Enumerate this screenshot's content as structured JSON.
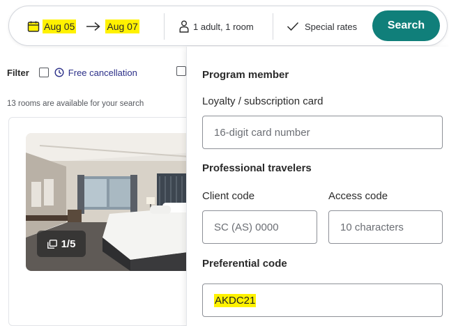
{
  "search": {
    "checkin": "Aug 05",
    "checkout": "Aug 07",
    "guests": "1 adult, 1 room",
    "special_rates": "Special rates",
    "search_label": "Search"
  },
  "filter": {
    "label": "Filter",
    "free_cancellation": "Free cancellation"
  },
  "results": {
    "count_text": "13 rooms are available for your search"
  },
  "room_card": {
    "photo_counter": "1/5"
  },
  "panel": {
    "program_member_title": "Program member",
    "loyalty_label": "Loyalty / subscription card",
    "loyalty_placeholder": "16-digit card number",
    "professional_title": "Professional travelers",
    "client_code_label": "Client code",
    "client_code_placeholder": "SC (AS) 0000",
    "access_code_label": "Access code",
    "access_code_placeholder": "10 characters",
    "preferential_label": "Preferential code",
    "preferential_value": "AKDC21"
  },
  "colors": {
    "accent": "#107f7a",
    "highlight": "#fff200",
    "link": "#2b2f88"
  }
}
